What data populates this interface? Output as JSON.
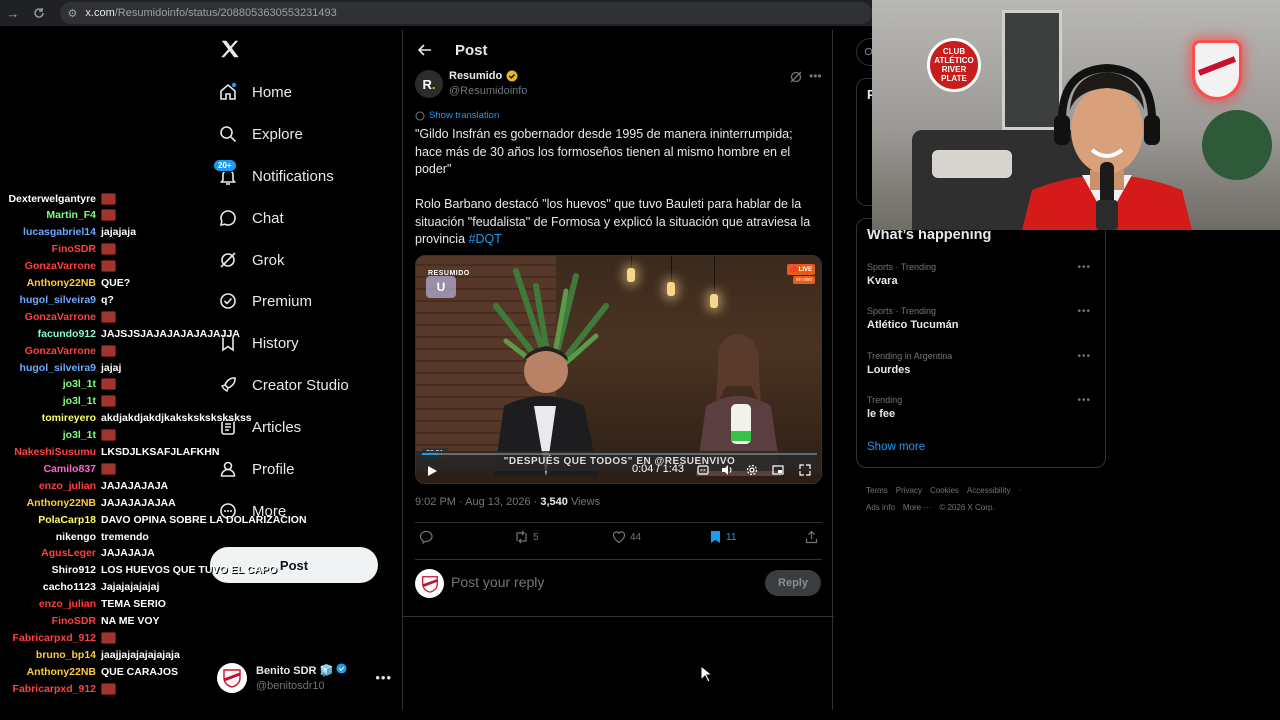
{
  "browser": {
    "url_domain": "x.com",
    "url_path": "/Resumidoinfo/status/2088053630553231493"
  },
  "nav": {
    "items": [
      {
        "label": "Home",
        "icon": "home-icon"
      },
      {
        "label": "Explore",
        "icon": "search-icon"
      },
      {
        "label": "Notifications",
        "icon": "bell-icon",
        "badge": "20+"
      },
      {
        "label": "Chat",
        "icon": "chat-icon"
      },
      {
        "label": "Grok",
        "icon": "grok-icon"
      },
      {
        "label": "Premium",
        "icon": "premium-icon"
      },
      {
        "label": "History",
        "icon": "bookmark-icon"
      },
      {
        "label": "Creator Studio",
        "icon": "rocket-icon"
      },
      {
        "label": "Articles",
        "icon": "article-icon"
      },
      {
        "label": "Profile",
        "icon": "profile-icon"
      },
      {
        "label": "More",
        "icon": "more-circle-icon"
      }
    ],
    "post_button": "Post",
    "account": {
      "name": "Benito SDR 🧊",
      "handle": "@benitosdr10"
    }
  },
  "main": {
    "header_title": "Post",
    "author": {
      "name": "Resumido",
      "handle": "@Resumidoinfo",
      "avatar_letter": "R",
      "avatar_dot": "."
    },
    "show_translation": "Show translation",
    "text_1": "\"Gildo Insfrán es gobernador desde 1995 de manera ininterrumpida; hace más de 30 años los formoseños tienen al mismo hombre en el poder\"",
    "text_2": "Rolo Barbano destacó \"los huevos\" que tuvo Bauleti para hablar de la situación \"feudalista\" de Formosa y explicó la situación que atraviesa la provincia ",
    "hashtag": "#DQT",
    "video": {
      "brand": "RESUMIDO",
      "logo_letter": "U",
      "live_tag": "🔴 LIVE",
      "live_sub": "en vivo",
      "banner": "\"DESPUÉS QUE TODOS\" EN @RESUENVIVO",
      "timecode_badge": "20:51",
      "time": "0:04 / 1:43",
      "progress": 0.04
    },
    "meta_time": "9:02 PM · Aug 13, 2026 · ",
    "views_count": "3,540",
    "views_label": " Views",
    "actions": {
      "reposts": "5",
      "likes": "44",
      "bookmarks": "11"
    },
    "reply_placeholder": "Post your reply",
    "reply_button": "Reply"
  },
  "right": {
    "premium_letter": "P",
    "trends_title": "What’s happening",
    "trends": [
      {
        "meta": "Sports · Trending",
        "name": "Kvara"
      },
      {
        "meta": "Sports · Trending",
        "name": "Atlético Tucumán"
      },
      {
        "meta": "Trending in Argentina",
        "name": "Lourdes"
      },
      {
        "meta": "Trending",
        "name": "le fee"
      }
    ],
    "show_more": "Show more",
    "footer_1": [
      "Terms",
      "Privacy",
      "Cookies",
      "Accessibility",
      "·"
    ],
    "footer_2": [
      "Ads info",
      "More ···",
      "© 2026 X Corp."
    ]
  },
  "chat": [
    {
      "user": "Dexterwelgantyre",
      "msg": "",
      "color": "#ffffff",
      "emote": true
    },
    {
      "user": "Martin_F4",
      "msg": "",
      "color": "#7fff7f",
      "emote": true
    },
    {
      "user": "lucasgabriel14",
      "msg": "jajajaja",
      "color": "#6ea8ff",
      "emote": false
    },
    {
      "user": "FinoSDR",
      "msg": "",
      "color": "#ff4040",
      "emote": true
    },
    {
      "user": "GonzaVarrone",
      "msg": "",
      "color": "#ff4040",
      "emote": true
    },
    {
      "user": "Anthony22NB",
      "msg": "QUE?",
      "color": "#ffcc33",
      "emote": false
    },
    {
      "user": "hugol_silveira9",
      "msg": "q?",
      "color": "#6ea8ff",
      "emote": false
    },
    {
      "user": "GonzaVarrone",
      "msg": "",
      "color": "#ff4040",
      "emote": true
    },
    {
      "user": "facundo912",
      "msg": "JAJSJSJAJAJAJAJAJAJJA",
      "color": "#7fffd4",
      "emote": false
    },
    {
      "user": "GonzaVarrone",
      "msg": "",
      "color": "#ff4040",
      "emote": true
    },
    {
      "user": "hugol_silveira9",
      "msg": "jajaj",
      "color": "#6ea8ff",
      "emote": false
    },
    {
      "user": "jo3l_1t",
      "msg": "",
      "color": "#7fff7f",
      "emote": true
    },
    {
      "user": "jo3l_1t",
      "msg": "",
      "color": "#7fff7f",
      "emote": true
    },
    {
      "user": "tomireyero",
      "msg": "akdjakdjakdjkakskskskskskss",
      "color": "#ffff66",
      "emote": false
    },
    {
      "user": "jo3l_1t",
      "msg": "",
      "color": "#7fff7f",
      "emote": true
    },
    {
      "user": "NakeshiSusumu",
      "msg": "LKSDJLKSAFJLAFKHN",
      "color": "#ff4040",
      "emote": false
    },
    {
      "user": "Camilo837",
      "msg": "",
      "color": "#ff66cc",
      "emote": true
    },
    {
      "user": "enzo_julian",
      "msg": "JAJAJAJAJA",
      "color": "#ff4040",
      "emote": false
    },
    {
      "user": "Anthony22NB",
      "msg": "JAJAJAJAJAA",
      "color": "#ffcc33",
      "emote": false
    },
    {
      "user": "PolaCarp18",
      "msg": "DAVO OPINA SOBRE LA DOLARIZACION",
      "color": "#ffff66",
      "emote": false
    },
    {
      "user": "nikengo",
      "msg": "tremendo",
      "color": "#ffffff",
      "emote": false
    },
    {
      "user": "AgusLeger",
      "msg": "JAJAJAJA",
      "color": "#ff4040",
      "emote": false
    },
    {
      "user": "Shiro912",
      "msg": "LOS HUEVOS QUE TUVO EL CAPO",
      "color": "#ffffff",
      "emote": false
    },
    {
      "user": "cacho1123",
      "msg": "Jajajajajajaj",
      "color": "#ffffff",
      "emote": false
    },
    {
      "user": "enzo_julian",
      "msg": "TEMA SERIO",
      "color": "#ff4040",
      "emote": false
    },
    {
      "user": "FinoSDR",
      "msg": "NA ME VOY",
      "color": "#ff4040",
      "emote": false
    },
    {
      "user": "Fabricarpxd_912",
      "msg": "",
      "color": "#ff4040",
      "emote": true
    },
    {
      "user": "bruno_bp14",
      "msg": "jaajjajajajajajaja",
      "color": "#ffcc33",
      "emote": false
    },
    {
      "user": "Anthony22NB",
      "msg": "QUE CARAJOS",
      "color": "#ffcc33",
      "emote": false
    },
    {
      "user": "Fabricarpxd_912",
      "msg": "",
      "color": "#ff4040",
      "emote": true
    }
  ],
  "webcam": {
    "logo_text": "CLUB ATLÉTICO RIVER PLATE"
  }
}
